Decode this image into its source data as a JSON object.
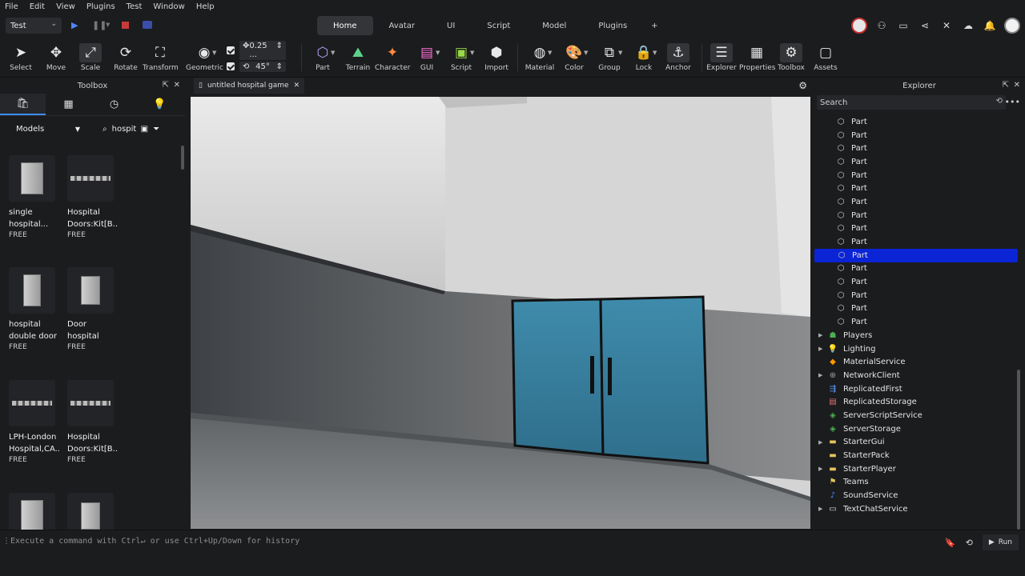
{
  "menu": [
    "File",
    "Edit",
    "View",
    "Plugins",
    "Test",
    "Window",
    "Help"
  ],
  "mode_select": {
    "value": "Test"
  },
  "tabs": [
    {
      "label": "Home",
      "active": true
    },
    {
      "label": "Avatar"
    },
    {
      "label": "UI"
    },
    {
      "label": "Script"
    },
    {
      "label": "Model"
    },
    {
      "label": "Plugins"
    }
  ],
  "tab_plus": "+",
  "ribbon": {
    "select": "Select",
    "move": "Move",
    "scale": "Scale",
    "rotate": "Rotate",
    "transform": "Transform",
    "geometric": "Geometric",
    "move_snap": "0.25 ...",
    "rotate_snap": "45°",
    "part": "Part",
    "terrain": "Terrain",
    "character": "Character",
    "gui": "GUI",
    "script": "Script",
    "import": "Import",
    "material": "Material",
    "color": "Color",
    "group": "Group",
    "lock": "Lock",
    "anchor": "Anchor",
    "explorer": "Explorer",
    "properties": "Properties",
    "toolbox": "Toolbox",
    "assets": "Assets"
  },
  "toolbox": {
    "title": "Toolbox",
    "category": "Models",
    "search_value": "hospita",
    "assets": [
      {
        "line1": "single",
        "line2": "hospital...",
        "price": "FREE"
      },
      {
        "line1": "Hospital",
        "line2": "Doors:Kit[B...",
        "price": "FREE"
      },
      {
        "line1": "hospital",
        "line2": "double door",
        "price": "FREE"
      },
      {
        "line1": "Door",
        "line2": "hospital",
        "price": "FREE"
      },
      {
        "line1": "LPH-London",
        "line2": "Hospital,CA...",
        "price": "FREE"
      },
      {
        "line1": "Hospital",
        "line2": "Doors:Kit[B...",
        "price": "FREE"
      }
    ]
  },
  "viewport": {
    "document_tab": "untitled hospital game"
  },
  "explorer": {
    "title": "Explorer",
    "search_placeholder": "Search",
    "parts": [
      "Part",
      "Part",
      "Part",
      "Part",
      "Part",
      "Part",
      "Part",
      "Part",
      "Part",
      "Part",
      "Part",
      "Part",
      "Part",
      "Part",
      "Part",
      "Part"
    ],
    "selected_index": 10,
    "services": [
      {
        "label": "Players",
        "arrow": true,
        "icon": "players-icon",
        "color": "#4caf50"
      },
      {
        "label": "Lighting",
        "arrow": true,
        "icon": "lightbulb-icon",
        "color": "#ffd54f"
      },
      {
        "label": "MaterialService",
        "arrow": false,
        "icon": "material-icon",
        "color": "#ff9800"
      },
      {
        "label": "NetworkClient",
        "arrow": true,
        "icon": "network-icon",
        "color": "#9e9e9e"
      },
      {
        "label": "ReplicatedFirst",
        "arrow": false,
        "icon": "replicated-first-icon",
        "color": "#5c9dff"
      },
      {
        "label": "ReplicatedStorage",
        "arrow": false,
        "icon": "replicated-storage-icon",
        "color": "#e57373"
      },
      {
        "label": "ServerScriptService",
        "arrow": false,
        "icon": "server-script-icon",
        "color": "#4caf50"
      },
      {
        "label": "ServerStorage",
        "arrow": false,
        "icon": "server-storage-icon",
        "color": "#4caf50"
      },
      {
        "label": "StarterGui",
        "arrow": true,
        "icon": "folder-icon",
        "color": "#e6c55a"
      },
      {
        "label": "StarterPack",
        "arrow": false,
        "icon": "folder-icon",
        "color": "#e6c55a"
      },
      {
        "label": "StarterPlayer",
        "arrow": true,
        "icon": "folder-icon",
        "color": "#e6c55a"
      },
      {
        "label": "Teams",
        "arrow": false,
        "icon": "teams-icon",
        "color": "#e6c55a"
      },
      {
        "label": "SoundService",
        "arrow": false,
        "icon": "sound-icon",
        "color": "#4a8cff"
      },
      {
        "label": "TextChatService",
        "arrow": true,
        "icon": "chat-icon",
        "color": "#dddddd"
      }
    ]
  },
  "command_bar": {
    "placeholder": "Execute a command with Ctrl↵ or use Ctrl+Up/Down for history",
    "run_label": "Run"
  },
  "colors": {
    "accent": "#3c8dff",
    "selection": "#0b24d6",
    "door": "#3f8bab"
  }
}
